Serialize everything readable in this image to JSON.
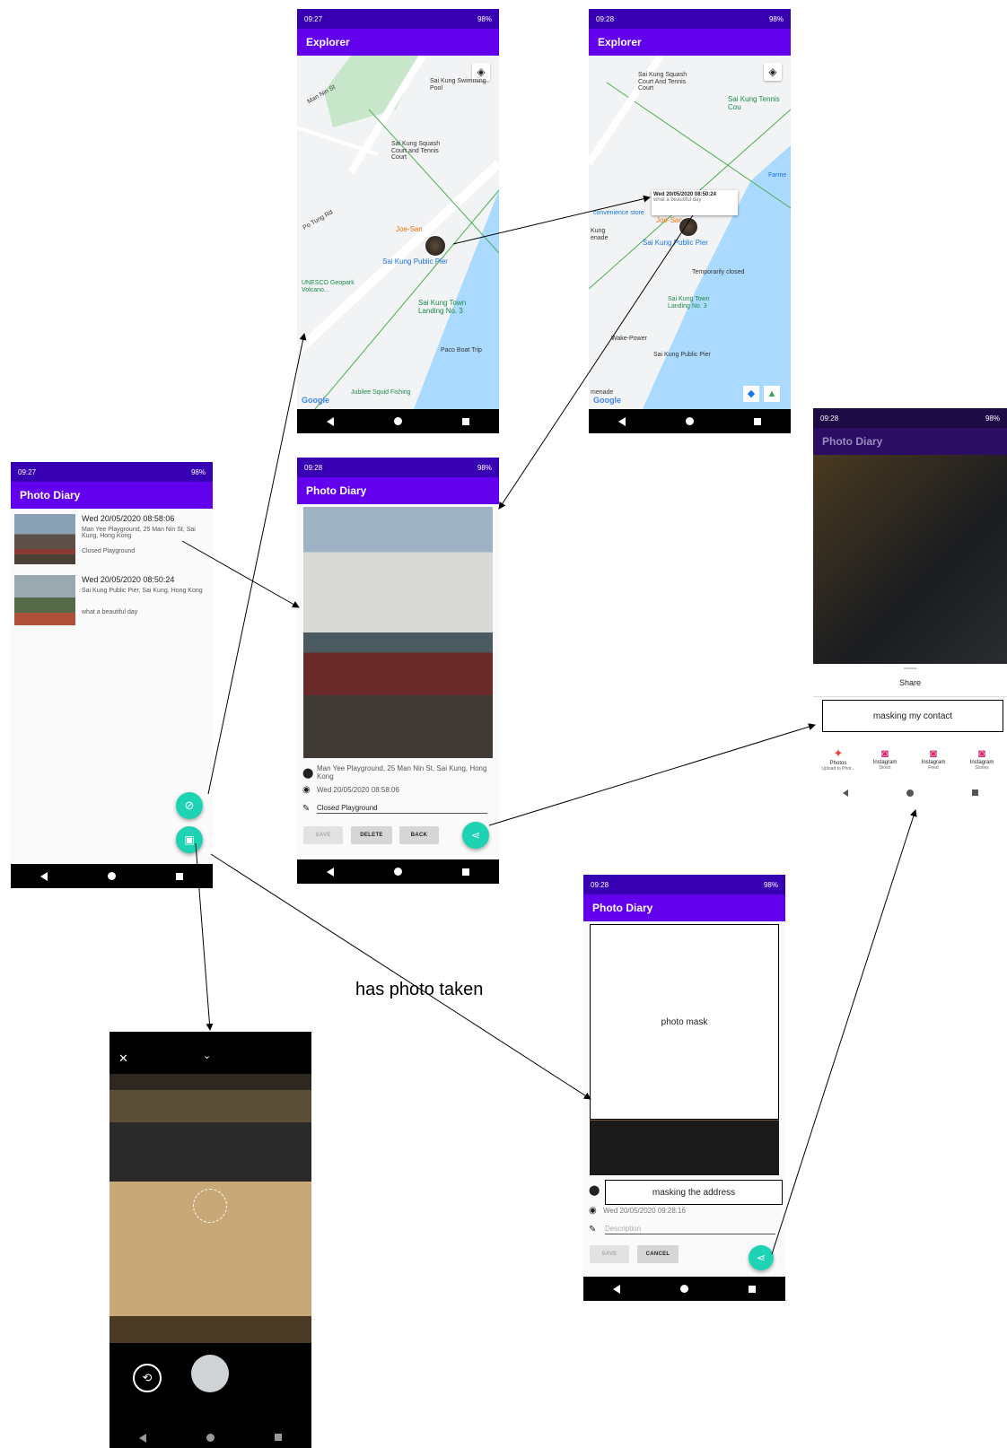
{
  "status": {
    "time_0927": "09:27",
    "time_0928": "09:28",
    "battery": "98%"
  },
  "explorer": {
    "title": "Explorer"
  },
  "photo_diary": {
    "title": "Photo Diary"
  },
  "map1": {
    "labels": {
      "sk_swimming": "Sai Kung Swimming Pool",
      "squash": "Sai Kung Squash Court and Tennis Court",
      "man_nin": "Man Nin St",
      "po_tung": "Po Tung Rd",
      "joe_san": "Joe-San",
      "pier": "Sai Kung Public Pier",
      "unesco": "UNESCO Geopark Volcano...",
      "landing": "Sai Kung Town Landing No. 3",
      "paco": "Paco Boat Trip",
      "jubilee": "Jubilee Squid Fishing",
      "google": "Google"
    }
  },
  "map2": {
    "labels": {
      "squash": "Sai Kung Squash Court And Tennis Court",
      "tennis": "Sai Kung Tennis Cou",
      "farmer": "Farme",
      "info_title": "Wed 20/05/2020 08:50:24",
      "info_desc": "what a beautiful day",
      "joe_san": "Joe-San",
      "convenience": "convenience store",
      "pier": "Sai Kung Public Pier",
      "kung_promenade": "Kung enade",
      "temp_closed": "Temporarily closed",
      "landing": "Sai Kung Town Landing No. 3",
      "wake": "Wake-Power",
      "pier2": "Sai Kung Public Pier",
      "google": "Google",
      "menade": "menade"
    }
  },
  "list": {
    "items": [
      {
        "date": "Wed 20/05/2020 08:58:06",
        "address": "Man Yee Playground, 25 Man Nin St, Sai Kung, Hong Kong",
        "desc": "Closed Playground"
      },
      {
        "date": "Wed 20/05/2020 08:50:24",
        "address": "Sai Kung Public Pier, Sai Kung, Hong Kong",
        "desc": "what a beautiful day"
      }
    ]
  },
  "detail": {
    "address": "Man Yee Playground, 25 Man Nin St, Sai Kung, Hong Kong",
    "date": "Wed 20/05/2020 08:58:06",
    "desc": "Closed Playground",
    "save": "SAVE",
    "delete": "DELETE",
    "back": "BACK"
  },
  "share": {
    "title": "Share",
    "masking_contact": "masking my contact",
    "apps": [
      {
        "name": "Photos",
        "sub": "Upload to Phot..."
      },
      {
        "name": "Instagram",
        "sub": "Direct"
      },
      {
        "name": "Instagram",
        "sub": "Feed"
      },
      {
        "name": "Instagram",
        "sub": "Stories"
      }
    ]
  },
  "new_entry": {
    "photo_mask": "photo mask",
    "masking_address": "masking the address",
    "date": "Wed 20/05/2020 09:28:16",
    "desc_placeholder": "Description",
    "save": "SAVE",
    "cancel": "CANCEL"
  },
  "caption": {
    "has_photo": "has photo taken"
  },
  "colors": {
    "primary": "#6200ee",
    "primary_dark": "#3700b3",
    "accent": "#1ed3b4",
    "water": "#aadaff",
    "park": "#c8e6c9"
  },
  "icons": [
    "location-pin-icon",
    "watch-icon",
    "pencil-icon",
    "share-icon",
    "compass-icon",
    "add-photo-icon",
    "close-icon",
    "chevron-down-icon",
    "switch-camera-icon",
    "shutter-button",
    "my-location-icon"
  ]
}
